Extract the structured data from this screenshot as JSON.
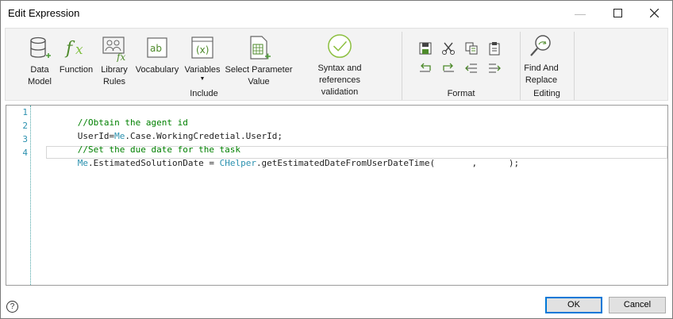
{
  "window": {
    "title": "Edit Expression"
  },
  "ribbon": {
    "include": {
      "label": "Include",
      "buttons": [
        {
          "label": "Data\nModel",
          "icon": "database-icon"
        },
        {
          "label": "Function",
          "icon": "function-fx-icon"
        },
        {
          "label": "Library\nRules",
          "icon": "library-rules-icon"
        },
        {
          "label": "Vocabulary",
          "icon": "vocabulary-icon"
        },
        {
          "label": "Variables",
          "icon": "variables-icon"
        },
        {
          "label": "Select Parameter\nValue",
          "icon": "select-parameter-icon"
        },
        {
          "label": "Syntax and references\nvalidation",
          "icon": "validation-check-icon"
        }
      ]
    },
    "format": {
      "label": "Format",
      "icons": [
        "save-icon",
        "cut-icon",
        "copy-icon",
        "paste-icon",
        "undo-icon",
        "redo-icon",
        "outdent-icon",
        "indent-icon"
      ]
    },
    "editing": {
      "label": "Editing",
      "find_label": "Find And\nReplace"
    }
  },
  "editor": {
    "line_numbers": [
      "1",
      "2",
      "3",
      "4"
    ],
    "lines": {
      "l1": "//Obtain the agent id",
      "l2a": "UserId=",
      "l2b": "Me",
      "l2c": ".Case.WorkingCredetial.UserId;",
      "l3": "//Set the due date for the task",
      "l4a": "Me",
      "l4b": ".EstimatedSolutionDate = ",
      "l4c": "CHelper",
      "l4d": ".getEstimatedDateFromUserDateTime(       ,      );"
    }
  },
  "footer": {
    "help": "?",
    "ok": "OK",
    "cancel": "Cancel"
  }
}
